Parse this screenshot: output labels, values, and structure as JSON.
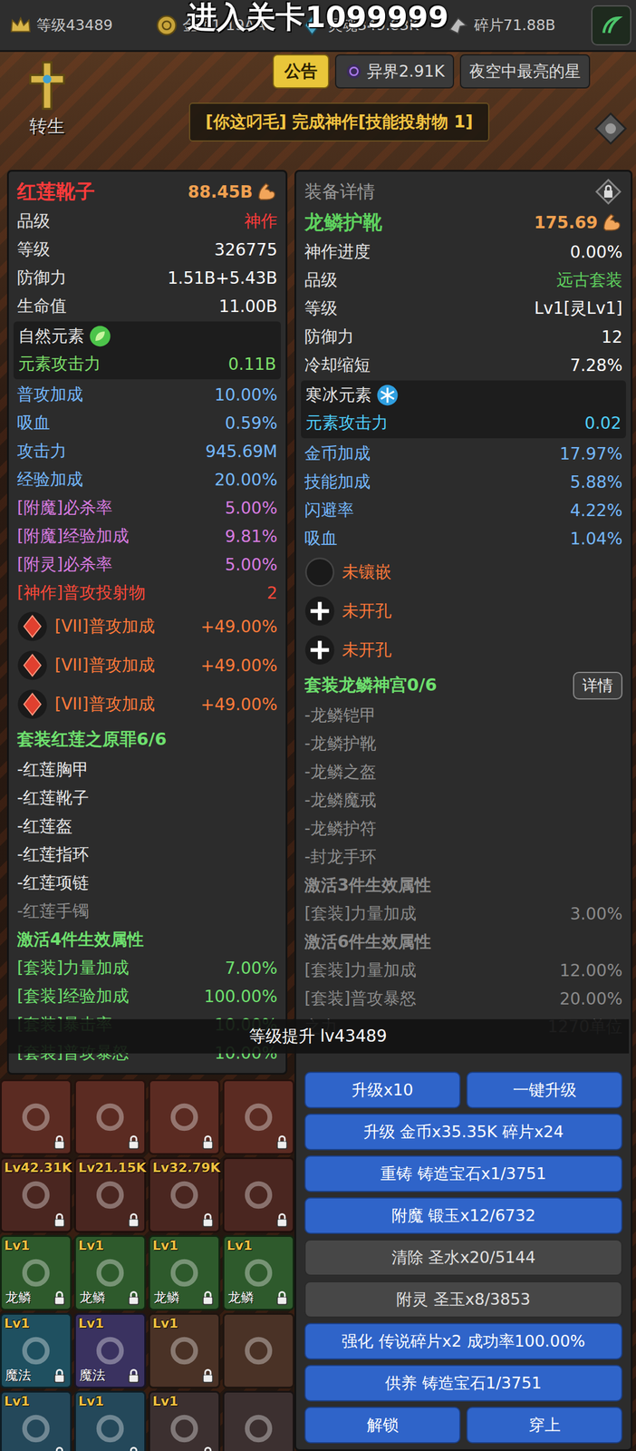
{
  "top_bar": {
    "stats": [
      {
        "kind": "level",
        "text": "等级43489"
      },
      {
        "kind": "gold",
        "text": "金币1.19AA"
      },
      {
        "kind": "soul",
        "text": "灵魂349.83K"
      },
      {
        "kind": "shard",
        "text": "碎片71.88B"
      }
    ],
    "stage_notice": "进入关卡1099999"
  },
  "menu": {
    "rebirth": "转生",
    "notice": "公告",
    "otherworld": "异界2.91K",
    "player": "夜空中最亮的星"
  },
  "banner": "[你这叼毛] 完成神作[技能投射物 1]",
  "panels": [
    {
      "header": "",
      "name": "红莲靴子",
      "name_color": "#ff3b3b",
      "power": "88.45B",
      "stats": [
        {
          "kind": "quality",
          "label": "品级",
          "value": "神作",
          "color": "#ff3b3b"
        },
        {
          "kind": "base",
          "label": "等级",
          "value": "326775",
          "color": "#ffffff"
        },
        {
          "kind": "base",
          "label": "防御力",
          "value": "1.51B+5.43B",
          "color": "#ffffff"
        },
        {
          "kind": "base",
          "label": "生命值",
          "value": "11.00B",
          "color": "#ffffff"
        }
      ],
      "element": {
        "kind": "nature",
        "name": "自然元素",
        "label": "元素攻击力",
        "value": "0.11B"
      },
      "bonuses": [
        {
          "kind": "bonus",
          "label": "普攻加成",
          "value": "10.00%"
        },
        {
          "kind": "bonus",
          "label": "吸血",
          "value": "0.59%"
        },
        {
          "kind": "bonus",
          "label": "攻击力",
          "value": "945.69M"
        },
        {
          "kind": "bonus",
          "label": "经验加成",
          "value": "20.00%"
        },
        {
          "kind": "enchant",
          "label": "[附魔]必杀率",
          "value": "5.00%"
        },
        {
          "kind": "enchant",
          "label": "[附魔]经验加成",
          "value": "9.81%"
        },
        {
          "kind": "enchant",
          "label": "[附灵]必杀率",
          "value": "5.00%"
        },
        {
          "kind": "masterwork",
          "label": "[神作]普攻投射物",
          "value": "2"
        }
      ],
      "slots": [
        {
          "kind": "gem",
          "label": "[VII]普攻加成",
          "value": "+49.00%"
        },
        {
          "kind": "gem",
          "label": "[VII]普攻加成",
          "value": "+49.00%"
        },
        {
          "kind": "gem",
          "label": "[VII]普攻加成",
          "value": "+49.00%"
        }
      ],
      "set": {
        "title": "套装红莲之原罪6/6",
        "detail_button": "",
        "pieces": [
          {
            "name": "-红莲胸甲",
            "owned": true
          },
          {
            "name": "-红莲靴子",
            "owned": true
          },
          {
            "name": "-红莲盔",
            "owned": true
          },
          {
            "name": "-红莲指环",
            "owned": true
          },
          {
            "name": "-红莲项链",
            "owned": true
          },
          {
            "name": "-红莲手镯",
            "owned": false
          }
        ],
        "tiers": [
          {
            "title": "激活4件生效属性",
            "active": true,
            "rows": [
              {
                "label": "[套装]力量加成",
                "value": "7.00%"
              },
              {
                "label": "[套装]经验加成",
                "value": "100.00%"
              },
              {
                "label": "[套装]暴击率",
                "value": "10.00%"
              },
              {
                "label": "[套装]普攻暴怒",
                "value": "10.00%"
              }
            ]
          }
        ]
      }
    },
    {
      "header": "装备详情",
      "name": "龙鳞护靴",
      "name_color": "#5fd35f",
      "power": "175.69",
      "stats": [
        {
          "kind": "base",
          "label": "神作进度",
          "value": "0.00%",
          "color": "#ffffff"
        },
        {
          "kind": "quality",
          "label": "品级",
          "value": "远古套装",
          "color": "#5fd35f"
        },
        {
          "kind": "base",
          "label": "等级",
          "value": "Lv1[灵Lv1]",
          "color": "#ffffff"
        },
        {
          "kind": "base",
          "label": "防御力",
          "value": "12",
          "color": "#ffffff"
        },
        {
          "kind": "base",
          "label": "冷却缩短",
          "value": "7.28%",
          "color": "#ffffff"
        }
      ],
      "element": {
        "kind": "ice",
        "name": "寒冰元素",
        "label": "元素攻击力",
        "value": "0.02"
      },
      "bonuses": [
        {
          "kind": "bonus",
          "label": "金币加成",
          "value": "17.97%"
        },
        {
          "kind": "bonus",
          "label": "技能加成",
          "value": "5.88%"
        },
        {
          "kind": "bonus",
          "label": "闪避率",
          "value": "4.22%"
        },
        {
          "kind": "bonus",
          "label": "吸血",
          "value": "1.04%"
        }
      ],
      "slots": [
        {
          "kind": "empty",
          "label": "未镶嵌",
          "value": ""
        },
        {
          "kind": "closed",
          "label": "未开孔",
          "value": ""
        },
        {
          "kind": "closed",
          "label": "未开孔",
          "value": ""
        }
      ],
      "set": {
        "title": "套装龙鳞神宫0/6",
        "detail_button": "详情",
        "pieces": [
          {
            "name": "-龙鳞铠甲",
            "owned": false
          },
          {
            "name": "-龙鳞护靴",
            "owned": false
          },
          {
            "name": "-龙鳞之盔",
            "owned": false
          },
          {
            "name": "-龙鳞魔戒",
            "owned": false
          },
          {
            "name": "-龙鳞护符",
            "owned": false
          },
          {
            "name": "-封龙手环",
            "owned": false
          }
        ],
        "tiers": [
          {
            "title": "激活3件生效属性",
            "active": false,
            "rows": [
              {
                "label": "[套装]力量加成",
                "value": "3.00%"
              }
            ]
          },
          {
            "title": "激活6件生效属性",
            "active": false,
            "rows": [
              {
                "label": "[套装]力量加成",
                "value": "12.00%"
              },
              {
                "label": "[套装]普攻暴怒",
                "value": "20.00%"
              },
              {
                "label": "之力",
                "value": "1270单位"
              }
            ]
          }
        ]
      }
    }
  ],
  "actions": [
    {
      "buttons": [
        {
          "label": "升级x10",
          "disabled": false
        },
        {
          "label": "一键升级",
          "disabled": false
        }
      ]
    },
    {
      "buttons": [
        {
          "label": "升级 金币x35.35K 碎片x24",
          "disabled": false
        }
      ]
    },
    {
      "buttons": [
        {
          "label": "重铸 铸造宝石x1/3751",
          "disabled": false
        }
      ]
    },
    {
      "buttons": [
        {
          "label": "附魔 锻玉x12/6732",
          "disabled": false
        }
      ]
    },
    {
      "buttons": [
        {
          "label": "清除 圣水x20/5144",
          "disabled": true
        }
      ]
    },
    {
      "buttons": [
        {
          "label": "附灵 圣玉x8/3853",
          "disabled": true
        }
      ]
    },
    {
      "buttons": [
        {
          "label": "强化 传说碎片x2 成功率100.00%",
          "disabled": false
        }
      ]
    },
    {
      "buttons": [
        {
          "label": "供养 铸造宝石1/3751",
          "disabled": false
        }
      ]
    },
    {
      "buttons": [
        {
          "label": "解锁",
          "disabled": false
        },
        {
          "label": "穿上",
          "disabled": false
        }
      ]
    }
  ],
  "toast": "等级提升 lv43489",
  "inventory": [
    {
      "slots": [
        {
          "level": "",
          "name": "",
          "locked": true,
          "color": "#5b2b22"
        },
        {
          "level": "",
          "name": "",
          "locked": true,
          "color": "#5b2b22"
        },
        {
          "level": "",
          "name": "",
          "locked": true,
          "color": "#5b2b22"
        },
        {
          "level": "",
          "name": "",
          "locked": true,
          "color": "#5b2b22"
        }
      ]
    },
    {
      "slots": [
        {
          "level": "Lv42.31K",
          "name": "",
          "locked": true,
          "color": "#4a2620"
        },
        {
          "level": "Lv21.15K",
          "name": "",
          "locked": true,
          "color": "#4a2620"
        },
        {
          "level": "Lv32.79K",
          "name": "",
          "locked": true,
          "color": "#4a2620"
        },
        {
          "level": "",
          "name": "",
          "locked": true,
          "color": "#4a2620"
        }
      ]
    },
    {
      "slots": [
        {
          "level": "Lv1",
          "name": "龙鳞",
          "locked": true,
          "color": "#2e5a2c"
        },
        {
          "level": "Lv1",
          "name": "龙鳞",
          "locked": true,
          "color": "#2e5a2c"
        },
        {
          "level": "Lv1",
          "name": "龙鳞",
          "locked": true,
          "color": "#2e5a2c"
        },
        {
          "level": "Lv1",
          "name": "龙鳞",
          "locked": true,
          "color": "#2e5a2c"
        }
      ]
    },
    {
      "slots": [
        {
          "level": "Lv1",
          "name": "魔法",
          "locked": true,
          "color": "#1f5060"
        },
        {
          "level": "Lv1",
          "name": "魔法",
          "locked": true,
          "color": "#3a3260"
        },
        {
          "level": "Lv1",
          "name": "",
          "locked": true,
          "color": "#4a3226"
        },
        {
          "level": "",
          "name": "",
          "locked": false,
          "color": "#4a3226"
        }
      ]
    },
    {
      "slots": [
        {
          "level": "Lv1",
          "name": "",
          "locked": true,
          "color": "#24485a"
        },
        {
          "level": "Lv1",
          "name": "",
          "locked": true,
          "color": "#24485a"
        },
        {
          "level": "Lv1",
          "name": "",
          "locked": true,
          "color": "#3c3030"
        },
        {
          "level": "",
          "name": "",
          "locked": false,
          "color": "#3c3030"
        }
      ]
    }
  ]
}
